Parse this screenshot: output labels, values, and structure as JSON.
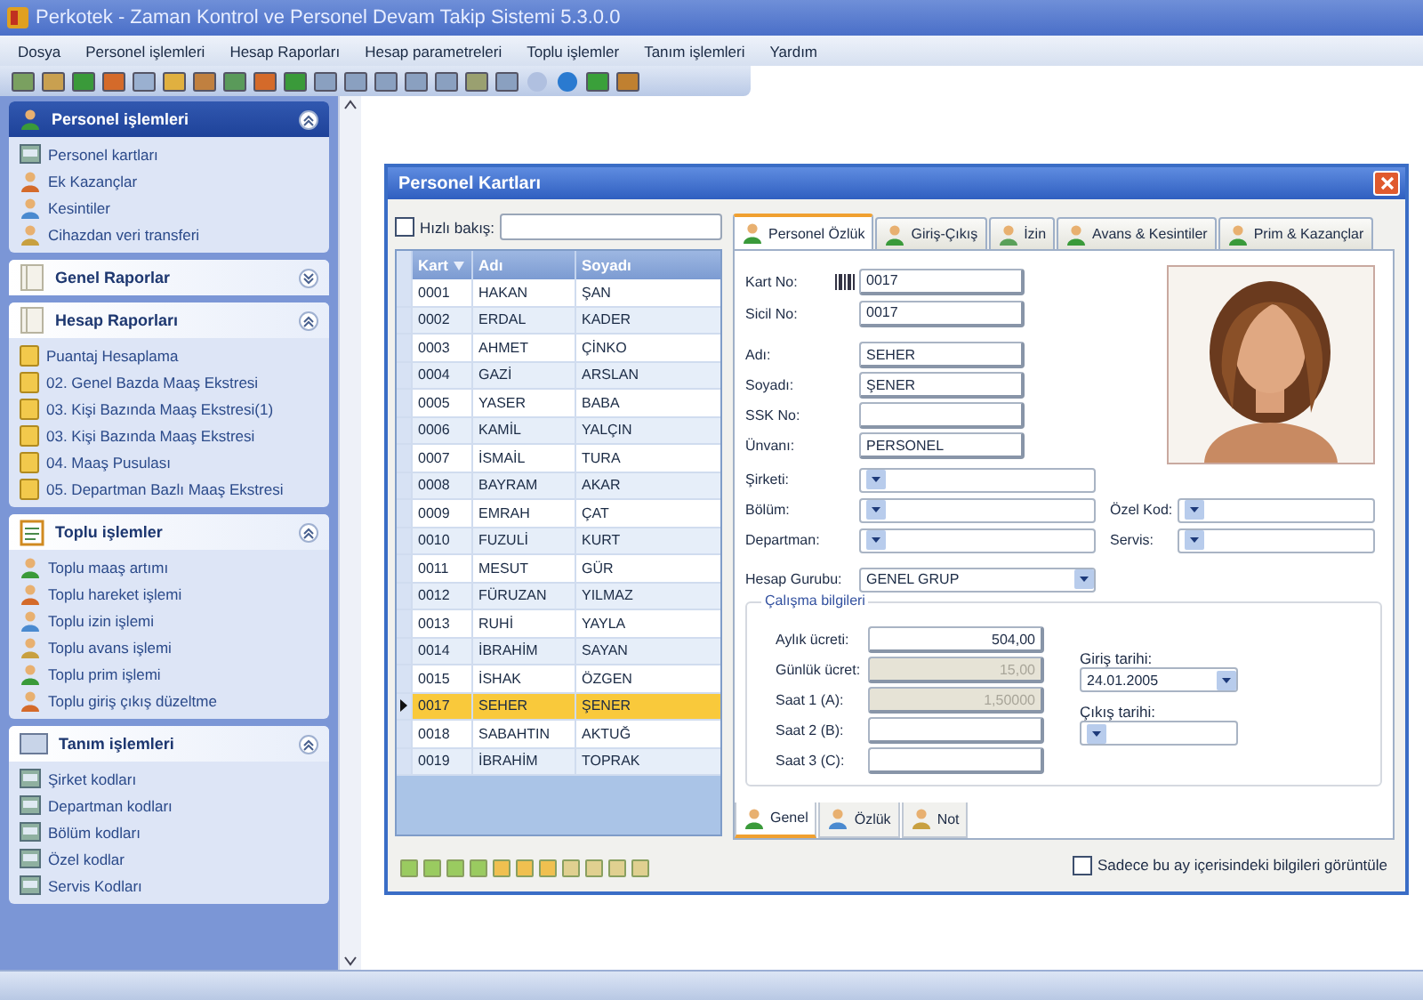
{
  "window": {
    "title": "Perkotek - Zaman Kontrol ve Personel Devam Takip Sistemi 5.3.0.0"
  },
  "menu": [
    "Dosya",
    "Personel işlemleri",
    "Hesap Raporları",
    "Hesap parametreleri",
    "Toplu işlemler",
    "Tanım işlemleri",
    "Yardım"
  ],
  "sidebar": {
    "groups": [
      {
        "title": "Personel işlemleri",
        "expanded": true,
        "active": true,
        "items": [
          "Personel kartları",
          "Ek Kazançlar",
          "Kesintiler",
          "Cihazdan veri transferi"
        ]
      },
      {
        "title": "Genel Raporlar",
        "expanded": false,
        "active": false
      },
      {
        "title": "Hesap Raporları",
        "expanded": true,
        "active": false,
        "items": [
          "Puantaj Hesaplama",
          "02. Genel Bazda Maaş Ekstresi",
          "03. Kişi Bazında Maaş Ekstresi(1)",
          "03. Kişi Bazında Maaş Ekstresi",
          "04. Maaş Pusulası",
          "05. Departman Bazlı Maaş Ekstresi"
        ]
      },
      {
        "title": "Toplu işlemler",
        "expanded": true,
        "active": false,
        "items": [
          "Toplu maaş artımı",
          "Toplu hareket işlemi",
          "Toplu izin işlemi",
          "Toplu avans işlemi",
          "Toplu prim işlemi",
          "Toplu giriş çıkış düzeltme"
        ]
      },
      {
        "title": "Tanım işlemleri",
        "expanded": true,
        "active": false,
        "items": [
          "Şirket kodları",
          "Departman kodları",
          "Bölüm kodları",
          "Özel kodlar",
          "Servis Kodları"
        ]
      }
    ]
  },
  "dialog": {
    "title": "Personel Kartları",
    "quick_search": {
      "label": "Hızlı bakış:",
      "checked": false
    },
    "grid": {
      "columns": [
        "Kart",
        "Adı",
        "Soyadı"
      ],
      "rows": [
        {
          "cells": [
            "0001",
            "HAKAN",
            "ŞAN"
          ],
          "selected": false
        },
        {
          "cells": [
            "0002",
            "ERDAL",
            "KADER"
          ],
          "selected": false
        },
        {
          "cells": [
            "0003",
            "AHMET",
            "ÇİNKO"
          ],
          "selected": false
        },
        {
          "cells": [
            "0004",
            "GAZİ",
            "ARSLAN"
          ],
          "selected": false
        },
        {
          "cells": [
            "0005",
            "YASER",
            "BABA"
          ],
          "selected": false
        },
        {
          "cells": [
            "0006",
            "KAMİL",
            "YALÇIN"
          ],
          "selected": false
        },
        {
          "cells": [
            "0007",
            "İSMAİL",
            "TURA"
          ],
          "selected": false
        },
        {
          "cells": [
            "0008",
            "BAYRAM",
            "AKAR"
          ],
          "selected": false
        },
        {
          "cells": [
            "0009",
            "EMRAH",
            "ÇAT"
          ],
          "selected": false
        },
        {
          "cells": [
            "0010",
            "FUZULİ",
            "KURT"
          ],
          "selected": false
        },
        {
          "cells": [
            "0011",
            "MESUT",
            "GÜR"
          ],
          "selected": false
        },
        {
          "cells": [
            "0012",
            "FÜRUZAN",
            "YILMAZ"
          ],
          "selected": false
        },
        {
          "cells": [
            "0013",
            "RUHİ",
            "YAYLA"
          ],
          "selected": false
        },
        {
          "cells": [
            "0014",
            "İBRAHİM",
            "SAYAN"
          ],
          "selected": false
        },
        {
          "cells": [
            "0015",
            "İSHAK",
            "ÖZGEN"
          ],
          "selected": false
        },
        {
          "cells": [
            "0017",
            "SEHER",
            "ŞENER"
          ],
          "selected": true
        },
        {
          "cells": [
            "0018",
            "SABAHTIN",
            "AKTUĞ"
          ],
          "selected": false
        },
        {
          "cells": [
            "0019",
            "İBRAHİM",
            "TOPRAK"
          ],
          "selected": false
        }
      ]
    },
    "tabs": [
      {
        "label": "Personel Özlük",
        "selected": true
      },
      {
        "label": "Giriş-Çıkış",
        "selected": false
      },
      {
        "label": "İzin",
        "selected": false
      },
      {
        "label": "Avans & Kesintiler",
        "selected": false
      },
      {
        "label": "Prim & Kazançlar",
        "selected": false
      }
    ],
    "form": {
      "id_fields": [
        {
          "label": "Kart No:",
          "value": "0017",
          "kind": "barcode"
        },
        {
          "label": "Sicil No:",
          "value": "0017",
          "kind": "text"
        }
      ],
      "name_fields": [
        {
          "label": "Adı:",
          "value": "SEHER"
        },
        {
          "label": "Soyadı:",
          "value": "ŞENER"
        },
        {
          "label": "SSK No:"
        },
        {
          "label": "Ünvanı:",
          "value": "PERSONEL"
        }
      ],
      "combo_rows": [
        {
          "left": {
            "label": "Şirketi:"
          }
        },
        {
          "left": {
            "label": "Bölüm:"
          },
          "right": {
            "label": "Özel Kod:"
          }
        },
        {
          "left": {
            "label": "Departman:"
          },
          "right": {
            "label": "Servis:"
          }
        },
        {
          "left": {
            "label": "Hesap Gurubu:",
            "value": "GENEL GRUP"
          }
        }
      ],
      "wage": {
        "title": "Çalışma bilgileri",
        "fields": [
          {
            "label": "Aylık ücreti:",
            "value": "504,00",
            "disabled": false
          },
          {
            "label": "Günlük ücret:",
            "value": "15,00",
            "disabled": true
          },
          {
            "label": "Saat 1 (A):",
            "value": "1,50000",
            "disabled": true
          },
          {
            "label": "Saat 2 (B):",
            "disabled": false
          },
          {
            "label": "Saat 3 (C):",
            "disabled": false
          }
        ],
        "dates": [
          {
            "label": "Giriş tarihi:",
            "value": "24.01.2005"
          },
          {
            "label": "Çıkış tarihi:"
          }
        ]
      }
    },
    "bottom_tabs": [
      {
        "label": "Genel",
        "selected": true
      },
      {
        "label": "Özlük",
        "selected": false
      },
      {
        "label": "Not",
        "selected": false
      }
    ],
    "footer_checkbox": {
      "label": "Sadece bu ay içerisindeki bilgileri görüntüle",
      "checked": false
    }
  }
}
